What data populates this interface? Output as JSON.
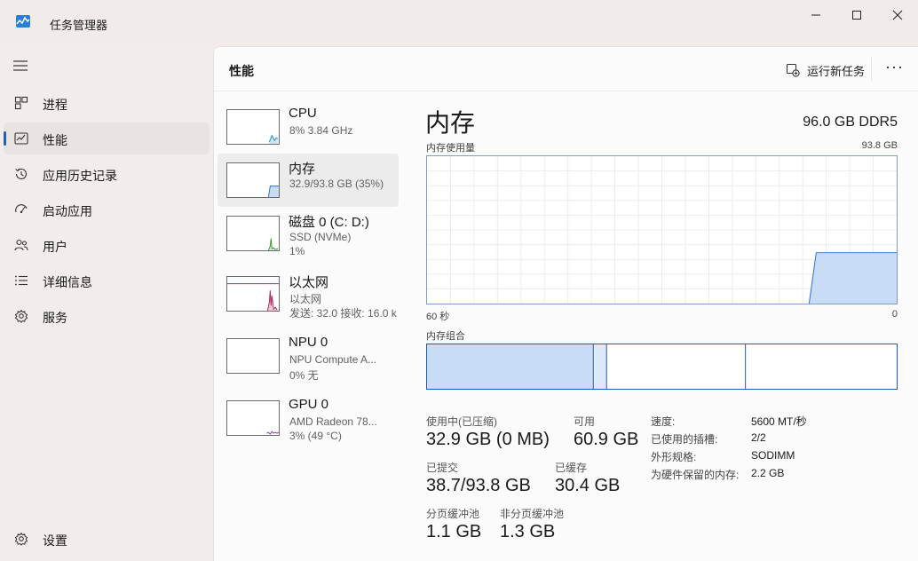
{
  "window": {
    "title": "任务管理器",
    "controls": {
      "minimize": "—",
      "maximize": "☐",
      "close": "✕"
    }
  },
  "sidebar": {
    "items": [
      {
        "label": "进程",
        "icon": "processes-icon"
      },
      {
        "label": "性能",
        "icon": "performance-icon",
        "active": true
      },
      {
        "label": "应用历史记录",
        "icon": "app-history-icon"
      },
      {
        "label": "启动应用",
        "icon": "startup-icon"
      },
      {
        "label": "用户",
        "icon": "users-icon"
      },
      {
        "label": "详细信息",
        "icon": "details-icon"
      },
      {
        "label": "服务",
        "icon": "services-icon"
      }
    ],
    "settings_label": "设置"
  },
  "header": {
    "title": "性能",
    "run_task_label": "运行新任务",
    "more_label": "···"
  },
  "devices": [
    {
      "name": "CPU",
      "line1": "8% 3.84 GHz",
      "line2": ""
    },
    {
      "name": "内存",
      "line1": "32.9/93.8 GB (35%)",
      "line2": "",
      "active": true
    },
    {
      "name": "磁盘 0 (C: D:)",
      "line1": "SSD (NVMe)",
      "line2": "1%"
    },
    {
      "name": "以太网",
      "line1": "以太网",
      "line2": "发送: 32.0 接收: 16.0 k"
    },
    {
      "name": "NPU 0",
      "line1": "NPU Compute A...",
      "line2": "0% 无"
    },
    {
      "name": "GPU 0",
      "line1": "AMD Radeon 78...",
      "line2": "3% (49 °C)"
    }
  ],
  "memory": {
    "title": "内存",
    "spec": "96.0 GB DDR5",
    "usage_label": "内存使用量",
    "max_label": "93.8 GB",
    "time_left": "60 秒",
    "time_right": "0",
    "composition_label": "内存组合",
    "usage_fraction": 0.35,
    "stats": {
      "in_use_label": "使用中(已压缩)",
      "in_use_value": "32.9 GB (0 MB)",
      "available_label": "可用",
      "available_value": "60.9 GB",
      "committed_label": "已提交",
      "committed_value": "38.7/93.8 GB",
      "cached_label": "已缓存",
      "cached_value": "30.4 GB",
      "paged_label": "分页缓冲池",
      "paged_value": "1.1 GB",
      "nonpaged_label": "非分页缓冲池",
      "nonpaged_value": "1.3 GB"
    },
    "details": [
      {
        "key": "速度:",
        "value": "5600 MT/秒"
      },
      {
        "key": "已使用的插槽:",
        "value": "2/2"
      },
      {
        "key": "外形规格:",
        "value": "SODIMM"
      },
      {
        "key": "为硬件保留的内存:",
        "value": "2.2 GB"
      }
    ]
  },
  "colors": {
    "accent": "#1f61c2",
    "memory_fill": "#c9dcf6",
    "memory_line": "#2d6ed6",
    "cpu_line": "#1e8fbd",
    "disk_line": "#3f8c3a",
    "ethernet_line": "#b5255f",
    "gpu_line": "#7d3aa8"
  }
}
